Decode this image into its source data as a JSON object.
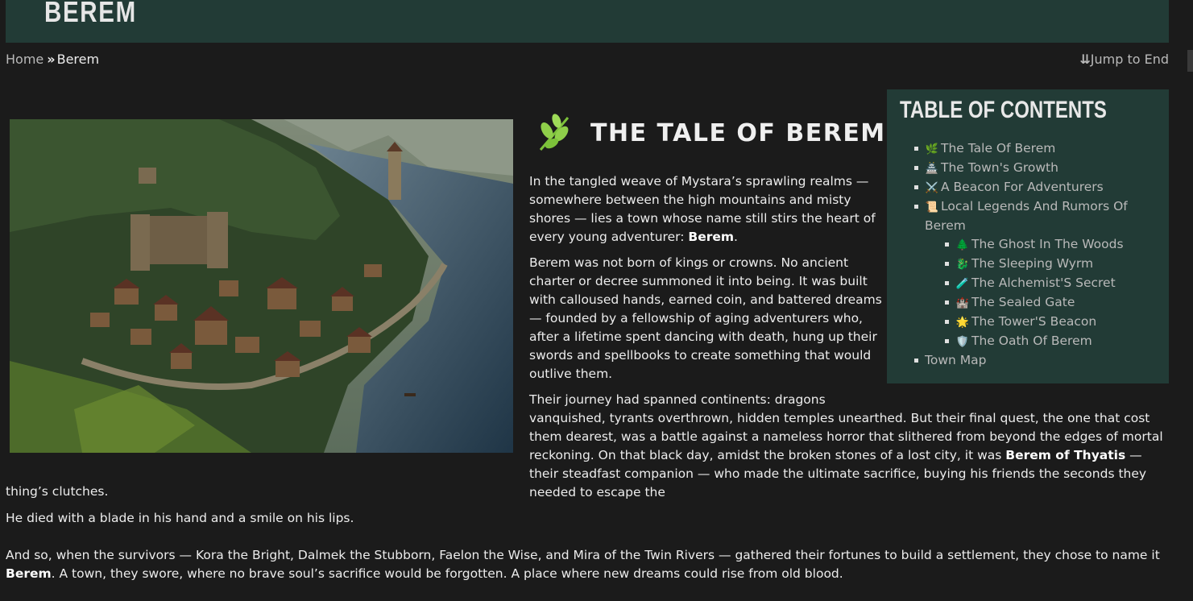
{
  "site": {
    "title": "BEREM"
  },
  "breadcrumb": {
    "home": "Home",
    "current": "Berem"
  },
  "jump": {
    "label": "Jump to End"
  },
  "article": {
    "title": "THE TALE OF BEREM",
    "p1_text": "In the tangled weave of Mystara’s sprawling realms — somewhere between the high mountains and misty shores — lies a town whose name still stirs the heart of every young adventurer: ",
    "p1_bold": "Berem",
    "p1_end": ".",
    "p2": "Berem was not born of kings or crowns. No ancient charter or decree summoned it into being. It was built with calloused hands, earned coin, and battered dreams — founded by a fellowship of aging adventurers who, after a lifetime spent dancing with death, hung up their swords and spellbooks to create something that would outlive them.",
    "p3_line1": "Their journey had spanned continents: dragons",
    "p3_text": "vanquished, tyrants overthrown, hidden temples unearthed. But their final quest, the one that cost them dearest, was a battle against a nameless horror that slithered from beyond the edges of mortal reckoning. On that black day, amidst the broken stones of a lost city, it was ",
    "p3_bold": "Berem of Thyatis",
    "p3_after": " — their steadfast companion — who made the ultimate sacrifice, buying his friends the seconds they needed to escape the",
    "p3_tail": "thing’s clutches.",
    "p4": "He died with a blade in his hand and a smile on his lips.",
    "p5_text": "And so, when the survivors — Kora the Bright, Dalmek the Stubborn, Faelon the Wise, and Mira of the Twin Rivers — gathered their fortunes to build a settlement, they chose to name it ",
    "p5_bold": "Berem",
    "p5_end": ". A town, they swore, where no brave soul’s sacrifice would be forgotten. A place where new dreams could rise from old blood."
  },
  "toc": {
    "heading": "TABLE OF CONTENTS",
    "items": [
      {
        "emoji": "🌿",
        "label": "The Tale Of Berem"
      },
      {
        "emoji": "🏯",
        "label": "The Town's Growth"
      },
      {
        "emoji": "⚔️",
        "label": "A Beacon For Adventurers"
      },
      {
        "emoji": "📜",
        "label": "Local Legends And Rumors Of Berem"
      },
      {
        "emoji": "",
        "label": "Town Map"
      }
    ],
    "subitems": [
      {
        "emoji": "🌲",
        "label": "The Ghost In The Woods"
      },
      {
        "emoji": "🐉",
        "label": "The Sleeping Wyrm"
      },
      {
        "emoji": "🧪",
        "label": "The Alchemist'S Secret"
      },
      {
        "emoji": "🏰",
        "label": "The Sealed Gate"
      },
      {
        "emoji": "🌟",
        "label": "The Tower'S Beacon"
      },
      {
        "emoji": "🛡️",
        "label": "The Oath Of Berem"
      }
    ]
  },
  "icons": {
    "title_icon": "leaf-icon",
    "breadcrumb_sep": "double-chevron-right-icon",
    "jump_icon": "double-chevron-down-icon"
  },
  "colors": {
    "header_bg": "#223b36",
    "page_bg": "#1b1b1b",
    "toc_bg": "#223b36",
    "leaf": "#8fcf4a"
  }
}
